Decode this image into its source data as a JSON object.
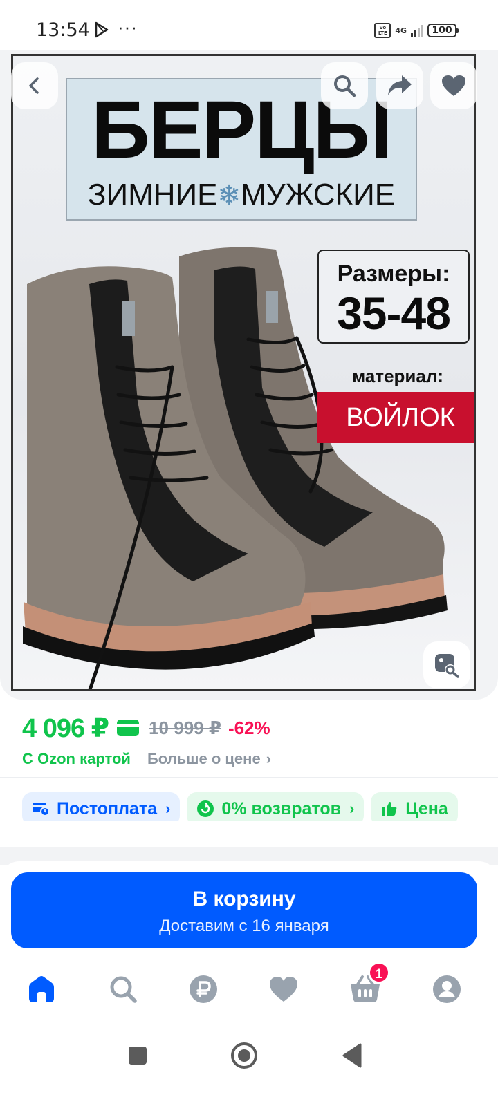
{
  "status_bar": {
    "time": "13:54",
    "overflow": "···",
    "network": "4G",
    "volte": "Vo LTE",
    "battery": "100"
  },
  "product_image": {
    "title": "БЕРЦЫ",
    "subtitle_left": "ЗИМНИЕ",
    "subtitle_sep": "❄",
    "subtitle_right": "МУЖСКИЕ",
    "sizes_label": "Размеры:",
    "sizes_value": "35-48",
    "material_label": "материал:",
    "material_value": "ВОЙЛОК",
    "icons": [
      "chevron-left-icon",
      "search-icon",
      "share-icon",
      "heart-icon",
      "image-search-icon"
    ]
  },
  "price": {
    "current": "4 096 ₽",
    "old": "10 999 ₽",
    "discount": "-62%",
    "card_note": "С Ozon картой",
    "more_link": "Больше о цене",
    "green": "#10c44c",
    "pink": "#f91155"
  },
  "chips": [
    {
      "label": "Постоплата",
      "icon": "card-clock-icon"
    },
    {
      "label": "0% возвратов",
      "icon": "return-icon"
    },
    {
      "label": "Цена",
      "icon": "thumb-up-icon"
    }
  ],
  "cta": {
    "title": "В корзину",
    "subtitle": "Доставим с 16 января",
    "color": "#005bff"
  },
  "bottom_nav": {
    "items": [
      "home-icon",
      "search-icon",
      "ruble-icon",
      "heart-icon",
      "basket-icon",
      "profile-icon"
    ],
    "cart_badge": "1",
    "active_color": "#005bff",
    "inactive_color": "#99a3ae"
  },
  "android_nav": [
    "recents-icon",
    "home-icon",
    "back-icon"
  ]
}
